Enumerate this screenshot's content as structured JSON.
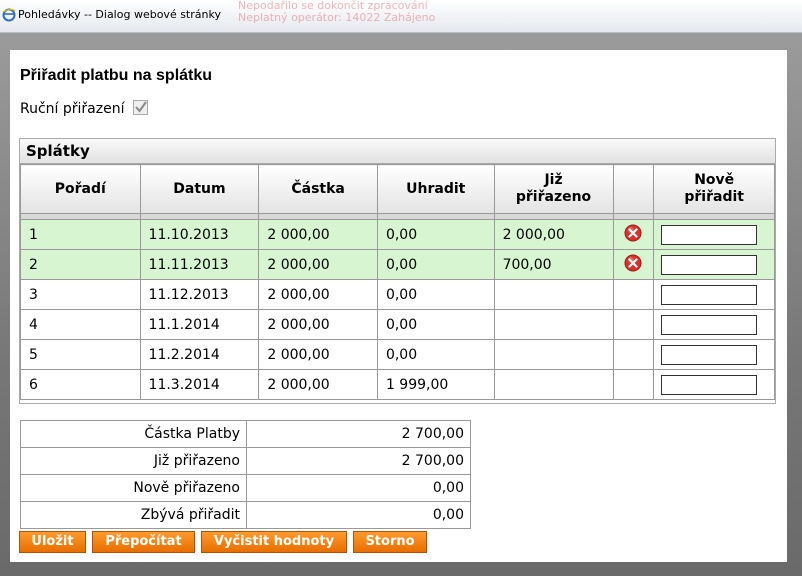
{
  "window": {
    "title": "Pohledávky -- Dialog webové stránky",
    "background_lines": [
      "Nepodařilo se dokončit zpracování",
      "Neplatný operátor: 14022 Zahájeno"
    ]
  },
  "heading": "Přiřadit platbu na splátku",
  "manual_assign": {
    "label": "Ruční přiřazení",
    "checked": true
  },
  "installments": {
    "panel_title": "Splátky",
    "columns": [
      "Pořadí",
      "Datum",
      "Částka",
      "Uhradit",
      "Již přiřazeno",
      "",
      "Nově přiřadit"
    ],
    "rows": [
      {
        "order": "1",
        "date": "11.10.2013",
        "amount": "2 000,00",
        "due": "0,00",
        "assigned": "2 000,00",
        "has_delete": true,
        "new": ""
      },
      {
        "order": "2",
        "date": "11.11.2013",
        "amount": "2 000,00",
        "due": "0,00",
        "assigned": "700,00",
        "has_delete": true,
        "new": ""
      },
      {
        "order": "3",
        "date": "11.12.2013",
        "amount": "2 000,00",
        "due": "0,00",
        "assigned": "",
        "has_delete": false,
        "new": ""
      },
      {
        "order": "4",
        "date": "11.1.2014",
        "amount": "2 000,00",
        "due": "0,00",
        "assigned": "",
        "has_delete": false,
        "new": ""
      },
      {
        "order": "5",
        "date": "11.2.2014",
        "amount": "2 000,00",
        "due": "0,00",
        "assigned": "",
        "has_delete": false,
        "new": ""
      },
      {
        "order": "6",
        "date": "11.3.2014",
        "amount": "2 000,00",
        "due": "1 999,00",
        "assigned": "",
        "has_delete": false,
        "new": ""
      }
    ]
  },
  "summary": [
    {
      "label": "Částka Platby",
      "value": "2 700,00"
    },
    {
      "label": "Již přiřazeno",
      "value": "2 700,00"
    },
    {
      "label": "Nově přiřazeno",
      "value": "0,00"
    },
    {
      "label": "Zbývá přiřadit",
      "value": "0,00"
    }
  ],
  "buttons": {
    "save": "Uložit",
    "recalc": "Přepočítat",
    "clear": "Vyčistit hodnoty",
    "cancel": "Storno"
  },
  "colors": {
    "assigned_row": "#d7f5d1",
    "button_orange": "#f58a0f",
    "delete_red": "#d9302a"
  }
}
